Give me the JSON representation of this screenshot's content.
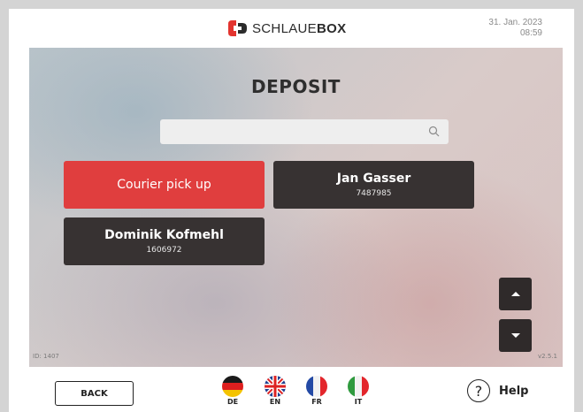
{
  "header": {
    "brand_light": "SCHLAUE",
    "brand_bold": "BOX",
    "date": "31. Jan. 2023",
    "time": "08:59"
  },
  "main": {
    "title": "DEPOSIT",
    "search": {
      "value": "",
      "placeholder": ""
    },
    "tiles": [
      {
        "name": "Courier pick up",
        "number": ""
      },
      {
        "name": "Jan Gasser",
        "number": "7487985"
      },
      {
        "name": "Dominik Kofmehl",
        "number": "1606972"
      }
    ],
    "id_label": "ID: 1407",
    "version": "v2.5.1"
  },
  "footer": {
    "back_label": "BACK",
    "languages": [
      {
        "code": "DE",
        "icon": "germany-flag-icon"
      },
      {
        "code": "EN",
        "icon": "uk-flag-icon"
      },
      {
        "code": "FR",
        "icon": "france-flag-icon"
      },
      {
        "code": "IT",
        "icon": "italy-flag-icon"
      }
    ],
    "help_symbol": "?",
    "help_label": "Help"
  },
  "colors": {
    "accent_red": "#e03e3e",
    "tile_dark": "#373232",
    "logo_red": "#e3342f"
  }
}
